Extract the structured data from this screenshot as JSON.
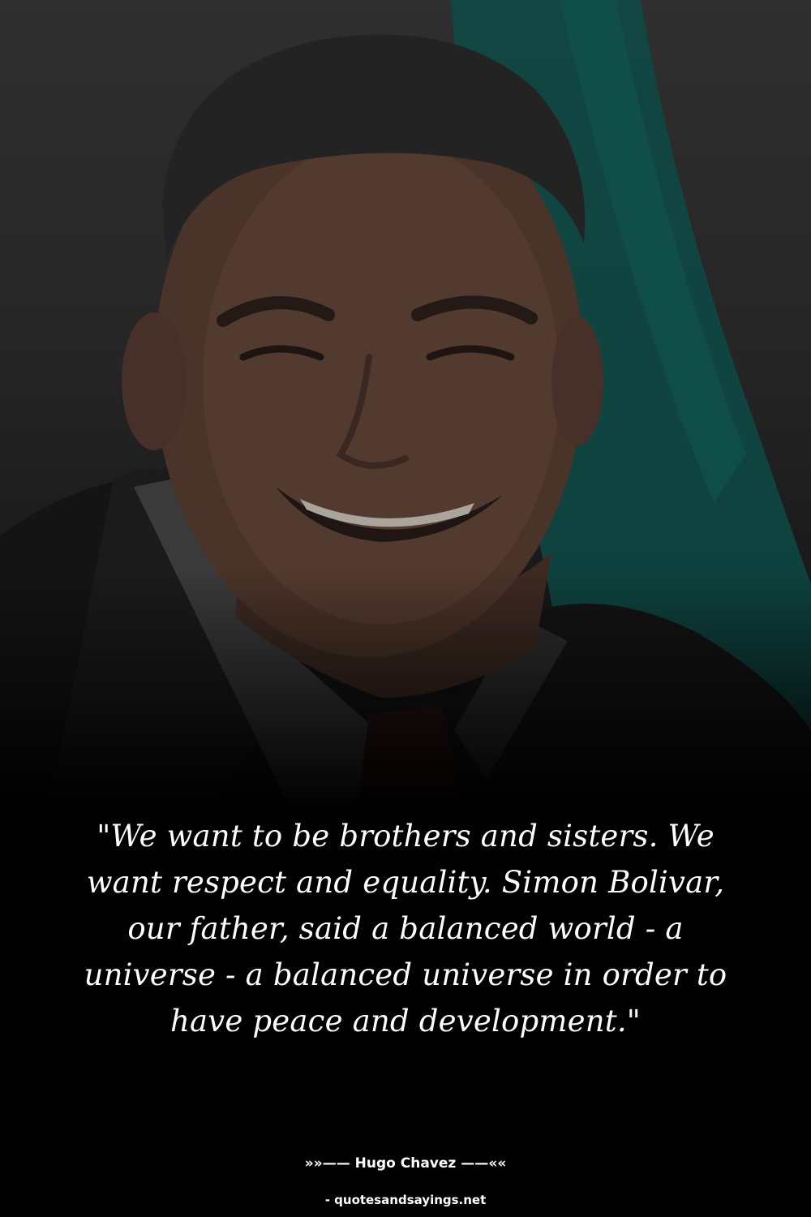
{
  "quote": {
    "text": "\"We want to be brothers and sisters. We want respect and equality. Simon Bolivar, our father, said a balanced world - a universe - a balanced universe in order to have peace and development.\""
  },
  "attribution": {
    "author_line": "»»—— Hugo Chavez ——««"
  },
  "source": {
    "label": "- quotesandsayings.net"
  },
  "colors": {
    "background": "#000000",
    "text": "#ffffff",
    "flag_teal": "#0d4a45"
  }
}
